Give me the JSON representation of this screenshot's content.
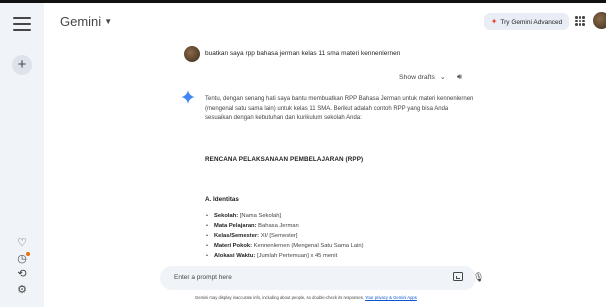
{
  "header": {
    "brand": "Gemini",
    "try_button": "Try Gemini Advanced"
  },
  "user_prompt": "buatkan saya rpp bahasa jerman kelas 11 sma materi kennenlernen",
  "drafts": {
    "label": "Show drafts"
  },
  "response": {
    "intro": "Tentu, dengan senang hati saya bantu membuatkan RPP Bahasa Jerman untuk materi kennenlernen (mengenal satu sama lain) untuk kelas 11 SMA. Berikut adalah contoh RPP yang bisa Anda sesuaikan dengan kebutuhan dan kurikulum sekolah Anda:",
    "title": "RENCANA PELAKSANAAN PEMBELAJARAN (RPP)",
    "section_a": "A. Identitas",
    "items": [
      {
        "label": "Sekolah:",
        "value": " [Nama Sekolah]"
      },
      {
        "label": "Mata Pelajaran:",
        "value": " Bahasa Jerman"
      },
      {
        "label": "Kelas/Semester:",
        "value": " XI/ [Semester]"
      },
      {
        "label": "Materi Pokok:",
        "value": " Kennenlernen (Mengenal Satu Sama Lain)"
      },
      {
        "label": "Alokasi Waktu:",
        "value": " [Jumlah Pertemuan] x 45 menit"
      }
    ]
  },
  "prompt": {
    "placeholder": "Enter a prompt here"
  },
  "disclaimer": {
    "text": "Gemini may display inaccurate info, including about people, so double-check its responses. ",
    "link": "Your privacy & Gemini Apps"
  },
  "colors": {
    "sidebar_bg": "#f0f4f9",
    "link": "#0b57d0",
    "accent_spark": "#e3472f",
    "gemini_star": "#4285f4"
  }
}
